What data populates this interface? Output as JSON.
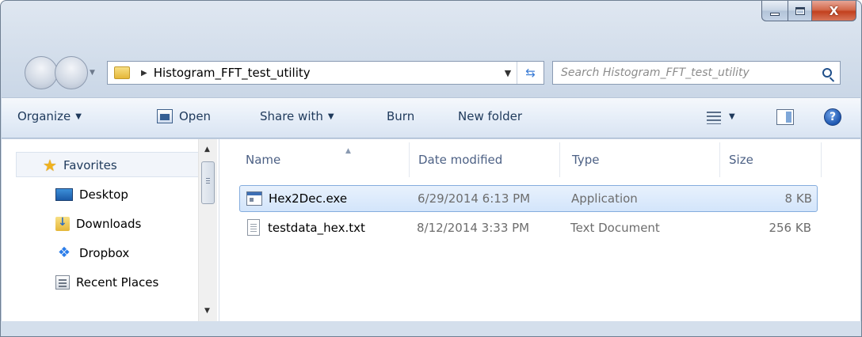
{
  "window": {
    "controls": {
      "close_glyph": "X"
    }
  },
  "address": {
    "breadcrumb": "Histogram_FFT_test_utility",
    "search_placeholder": "Search Histogram_FFT_test_utility"
  },
  "toolbar": {
    "organize": "Organize",
    "open": "Open",
    "share_with": "Share with",
    "burn": "Burn",
    "new_folder": "New folder",
    "help_glyph": "?"
  },
  "navigation": {
    "favorites_label": "Favorites",
    "items": [
      {
        "label": "Desktop",
        "icon": "desktop-icon"
      },
      {
        "label": "Downloads",
        "icon": "downloads-icon"
      },
      {
        "label": "Dropbox",
        "icon": "dropbox-icon"
      },
      {
        "label": "Recent Places",
        "icon": "recent-places-icon"
      }
    ]
  },
  "file_list": {
    "columns": [
      "Name",
      "Date modified",
      "Type",
      "Size"
    ],
    "rows": [
      {
        "name": "Hex2Dec.exe",
        "date_modified": "6/29/2014 6:13 PM",
        "type": "Application",
        "size": "8 KB",
        "icon": "application-icon",
        "selected": true
      },
      {
        "name": "testdata_hex.txt",
        "date_modified": "8/12/2014 3:33 PM",
        "type": "Text Document",
        "size": "256 KB",
        "icon": "text-document-icon",
        "selected": false
      }
    ]
  },
  "colors": {
    "accent": "#1e395b",
    "selection": "#d3e5fb",
    "close_button": "#c2401e"
  }
}
